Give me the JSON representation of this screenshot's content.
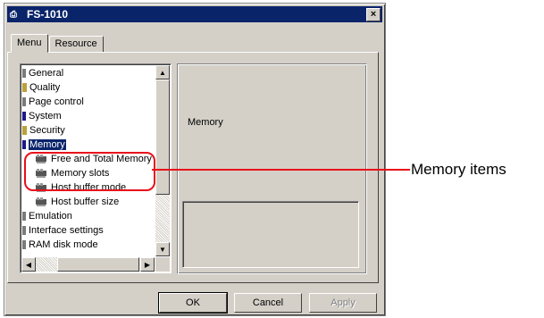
{
  "window": {
    "title": "FS-1010",
    "close_label": "×"
  },
  "tabs": [
    {
      "label": "Menu",
      "active": true
    },
    {
      "label": "Resource",
      "active": false
    }
  ],
  "tree": {
    "items": [
      {
        "label": "General"
      },
      {
        "label": "Quality"
      },
      {
        "label": "Page control"
      },
      {
        "label": "System"
      },
      {
        "label": "Security"
      },
      {
        "label": "Memory",
        "selected": true
      },
      {
        "label": "Free and Total Memory",
        "child": true
      },
      {
        "label": "Memory slots",
        "child": true
      },
      {
        "label": "Host buffer mode",
        "child": true
      },
      {
        "label": "Host buffer size",
        "child": true
      },
      {
        "label": "Emulation"
      },
      {
        "label": "Interface settings"
      },
      {
        "label": "RAM disk mode"
      }
    ]
  },
  "detail": {
    "caption": "Memory"
  },
  "buttons": {
    "ok": "OK",
    "cancel": "Cancel",
    "apply": "Apply"
  },
  "annotation": {
    "label": "Memory items",
    "color": "#e8101a"
  }
}
